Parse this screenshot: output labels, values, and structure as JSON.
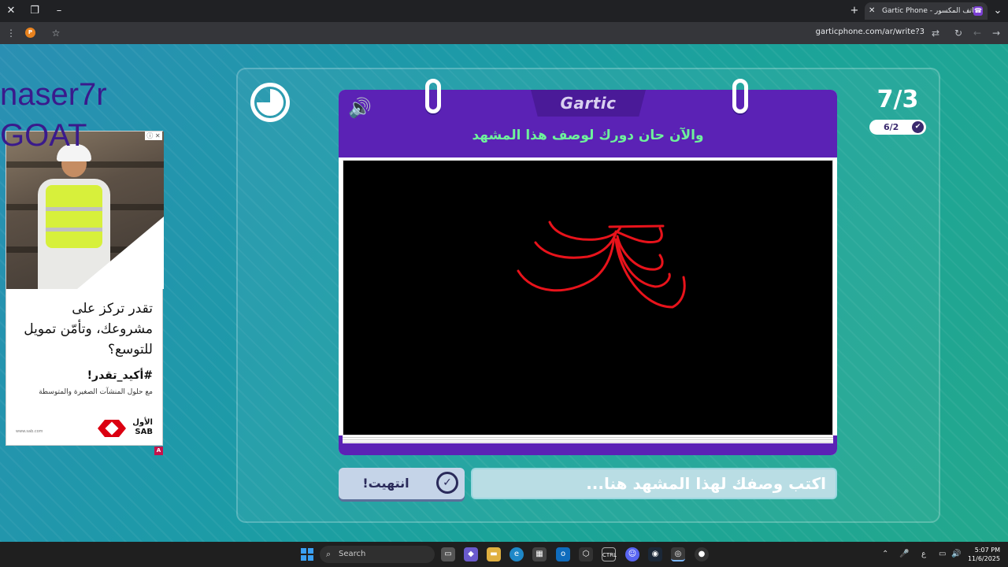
{
  "browser": {
    "tab_title": "Gartic Phone - الهاتف المكسور",
    "url": "garticphone.com/ar/write?3",
    "profile_initial": "P"
  },
  "overlay": {
    "line1": "naser7r",
    "line2": "GOAT"
  },
  "ad": {
    "headline": "تقدر تركز على مشروعك، وتأمّن تمويل للتوسع؟",
    "hashtag": "#أكيد_تقدر!",
    "subtext": "مع حلول المنشآت الصغيرة والمتوسطة",
    "brand_ar": "الأول",
    "brand_en": "SAB",
    "small_url": "www.sab.com",
    "badge": "A",
    "colors": {
      "brand": "#db0011"
    }
  },
  "game": {
    "logo": "Gartic",
    "prompt": "والآن حان دورك لوصف هذا المشهد",
    "round": "7/3",
    "players_done": "6/2",
    "done_label": "انتهيت!",
    "input_placeholder": "اكتب وصفك لهذا المشهد هنا...",
    "colors": {
      "header": "#5b22b5",
      "prompt": "#6ef29b",
      "stroke": "#e8131b"
    }
  },
  "taskbar": {
    "search_label": "Search",
    "time": "5:07 PM",
    "date": "11/6/2025",
    "lang": "ع"
  }
}
